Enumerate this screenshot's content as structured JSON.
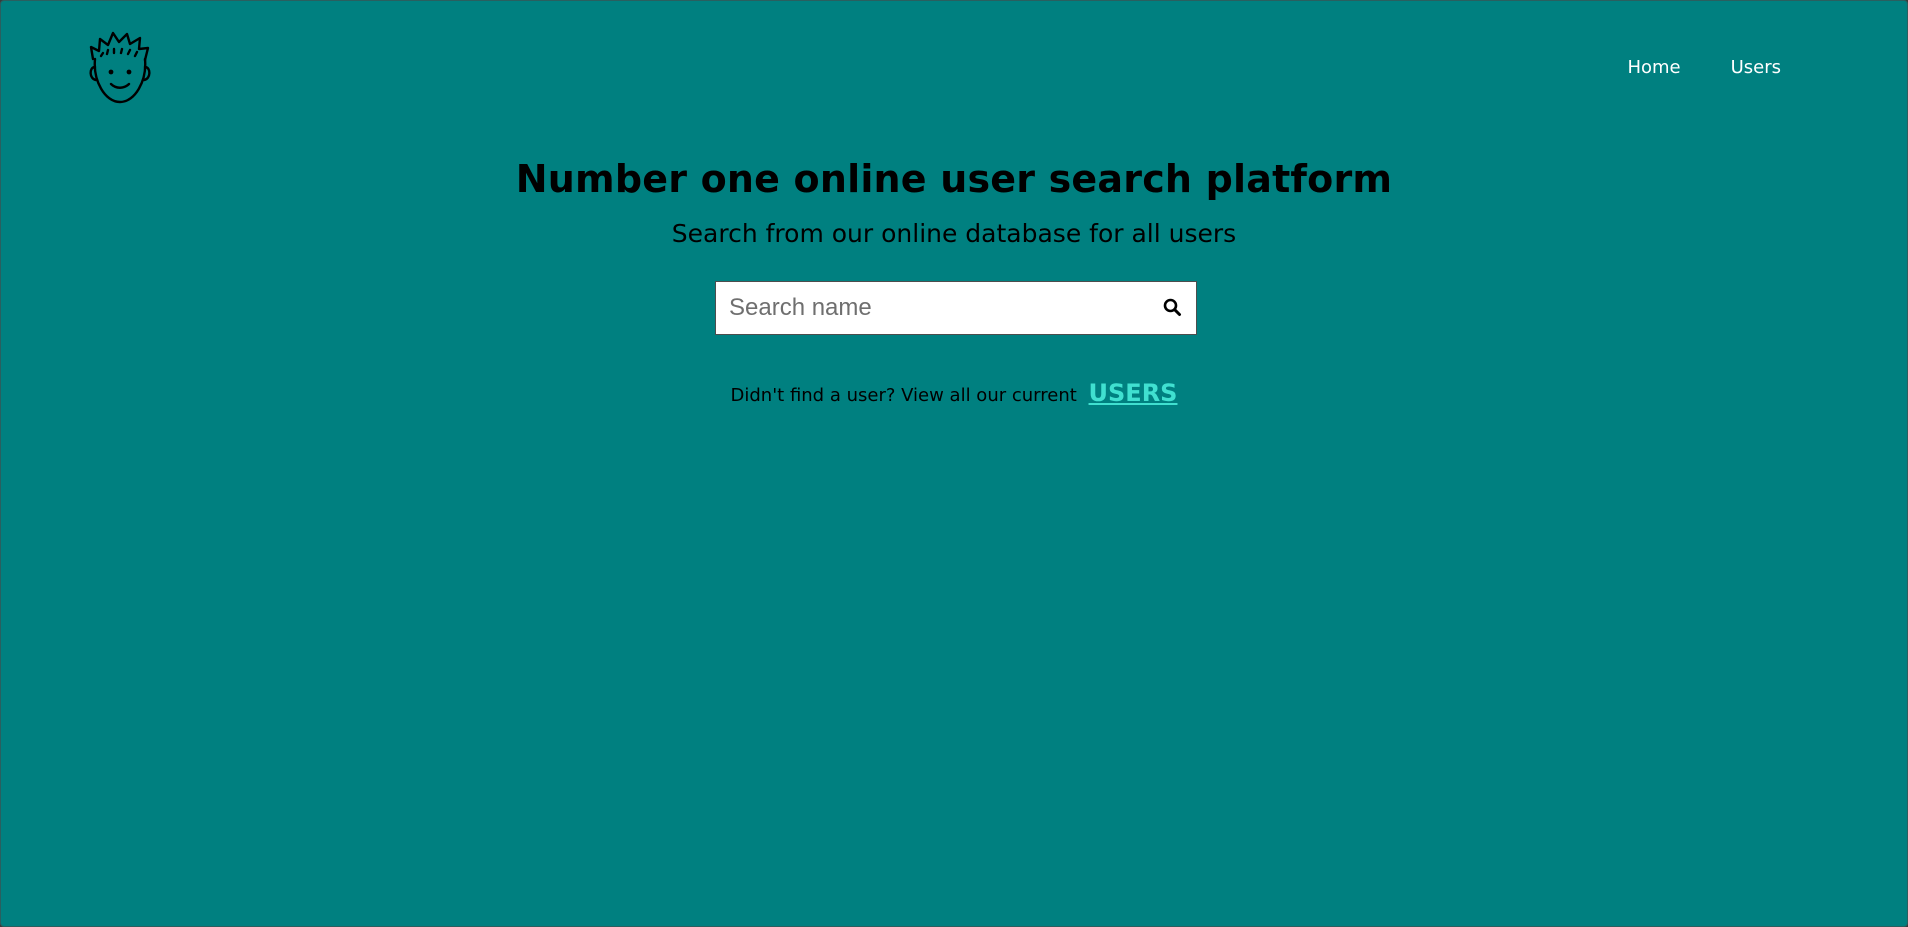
{
  "header": {
    "logo_icon": "smiling-face-icon",
    "nav": [
      {
        "label": "Home"
      },
      {
        "label": "Users"
      }
    ]
  },
  "hero": {
    "title": "Number one online user search platform",
    "subtitle": "Search from our online database for all users"
  },
  "search": {
    "placeholder": "Search name",
    "value": "",
    "button_icon": "search-icon"
  },
  "footer_hint": {
    "text": "Didn't find a user? View all our current",
    "link_label": "USERS"
  },
  "colors": {
    "background": "#008080",
    "link": "#40e0d0",
    "nav_text": "#ffffff"
  }
}
